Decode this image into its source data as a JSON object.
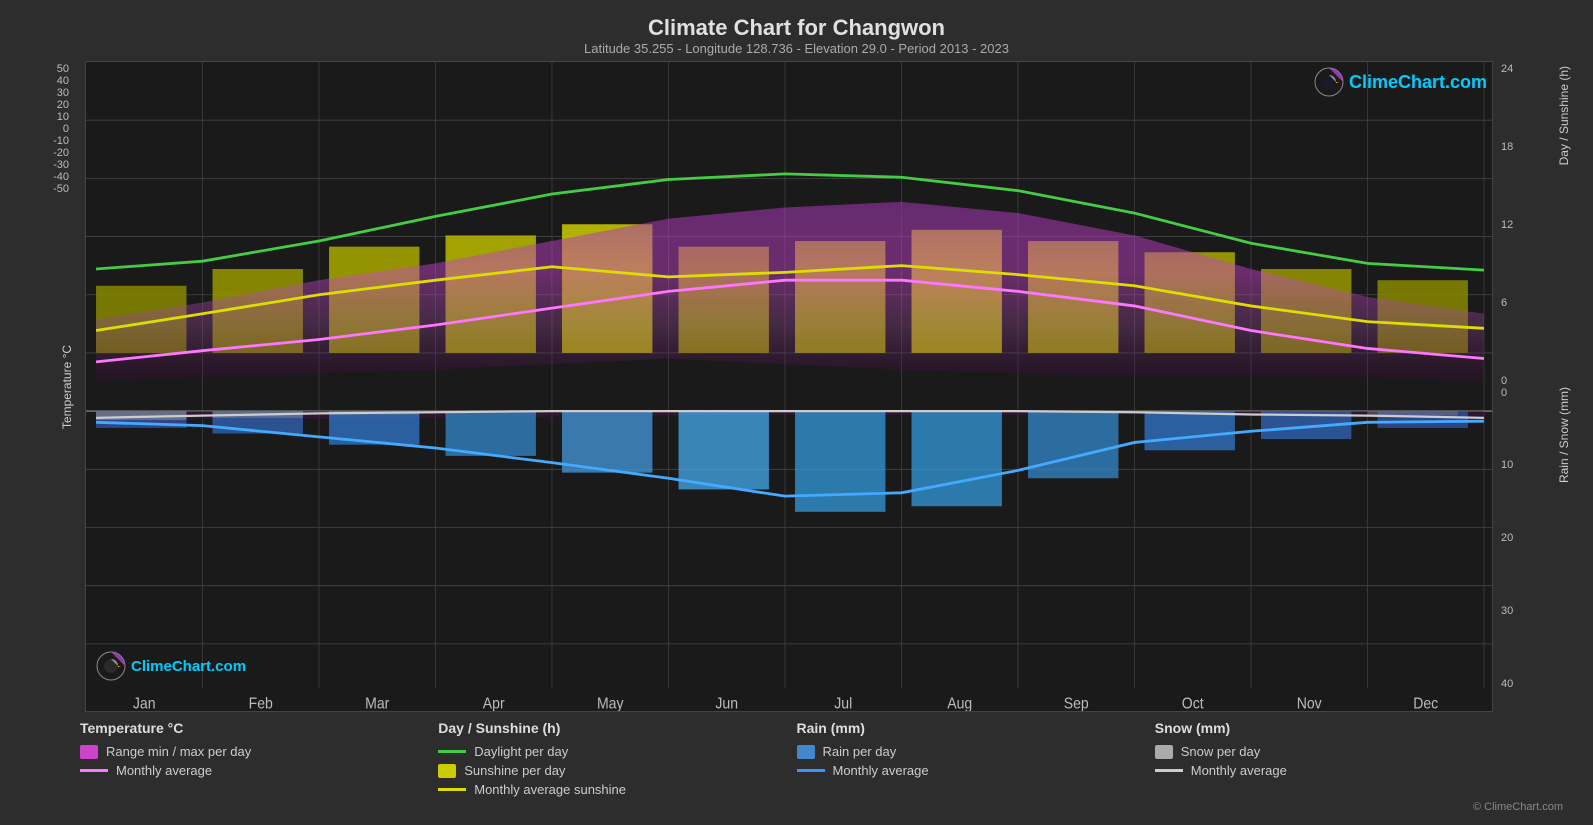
{
  "title": "Climate Chart for Changwon",
  "subtitle": "Latitude 35.255 - Longitude 128.736 - Elevation 29.0 - Period 2013 - 2023",
  "logo": {
    "text": "ClimeChart.com",
    "topleft_text": "ClimeChart.com",
    "topright_text": "ClimeChart.com"
  },
  "copyright": "© ClimeChart.com",
  "y_axis_left": {
    "label": "Temperature °C",
    "values": [
      "50",
      "40",
      "30",
      "20",
      "10",
      "0",
      "-10",
      "-20",
      "-30",
      "-40",
      "-50"
    ]
  },
  "y_axis_right_top": {
    "label": "Day / Sunshine (h)",
    "values": [
      "24",
      "18",
      "12",
      "6",
      "0"
    ]
  },
  "y_axis_right_bottom": {
    "label": "Rain / Snow (mm)",
    "values": [
      "0",
      "10",
      "20",
      "30",
      "40"
    ]
  },
  "months": [
    "Jan",
    "Feb",
    "Mar",
    "Apr",
    "May",
    "Jun",
    "Jul",
    "Aug",
    "Sep",
    "Oct",
    "Nov",
    "Dec"
  ],
  "legend": {
    "col1": {
      "title": "Temperature °C",
      "items": [
        {
          "type": "swatch",
          "color": "#cc44cc",
          "label": "Range min / max per day"
        },
        {
          "type": "line",
          "color": "#ff77ff",
          "label": "Monthly average"
        }
      ]
    },
    "col2": {
      "title": "Day / Sunshine (h)",
      "items": [
        {
          "type": "line",
          "color": "#44cc44",
          "label": "Daylight per day"
        },
        {
          "type": "swatch",
          "color": "#cccc00",
          "label": "Sunshine per day"
        },
        {
          "type": "line",
          "color": "#dddd00",
          "label": "Monthly average sunshine"
        }
      ]
    },
    "col3": {
      "title": "Rain (mm)",
      "items": [
        {
          "type": "swatch",
          "color": "#4488cc",
          "label": "Rain per day"
        },
        {
          "type": "line",
          "color": "#3399ff",
          "label": "Monthly average"
        }
      ]
    },
    "col4": {
      "title": "Snow (mm)",
      "items": [
        {
          "type": "swatch",
          "color": "#aaaaaa",
          "label": "Snow per day"
        },
        {
          "type": "line",
          "color": "#cccccc",
          "label": "Monthly average"
        }
      ]
    }
  }
}
